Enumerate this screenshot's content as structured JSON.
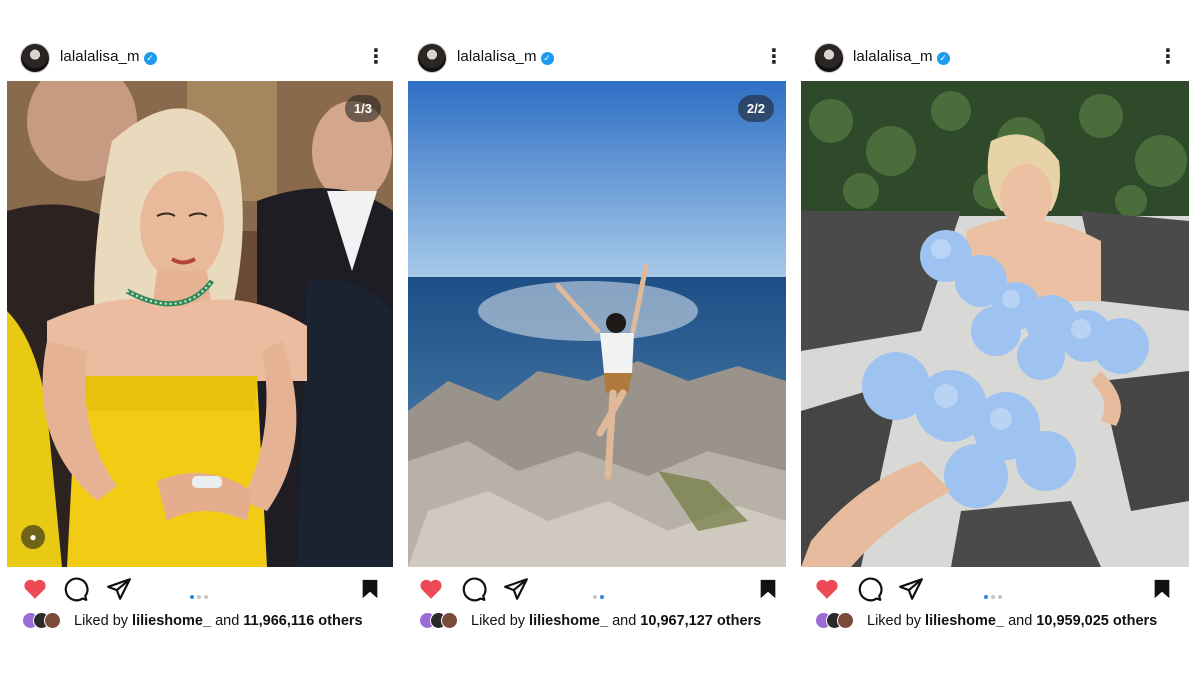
{
  "posts": [
    {
      "username": "lalalalisa_m",
      "counter": "1/3",
      "liked_prefix": "Liked by",
      "liked_user": "lilieshome_",
      "liked_mid": "and",
      "liked_count": "11,966,116 others",
      "active_dot": 0
    },
    {
      "username": "lalalalisa_m",
      "counter": "2/2",
      "liked_prefix": "Liked by",
      "liked_user": "lilieshome_",
      "liked_mid": "and",
      "liked_count": "10,967,127 others",
      "active_dot": 1
    },
    {
      "username": "lalalalisa_m",
      "counter": "",
      "liked_prefix": "Liked by",
      "liked_user": "lilieshome_",
      "liked_mid": "and",
      "liked_count": "10,959,025 others",
      "active_dot": 0
    }
  ],
  "icons": [
    "heart-icon",
    "comment-icon",
    "share-icon",
    "bookmark-icon",
    "more-options-icon",
    "verified-icon",
    "tagged-user-icon"
  ],
  "colors": {
    "like_red": "#ed4956",
    "verified_blue": "#1d9bf0",
    "dot_active": "#1e88e5"
  }
}
